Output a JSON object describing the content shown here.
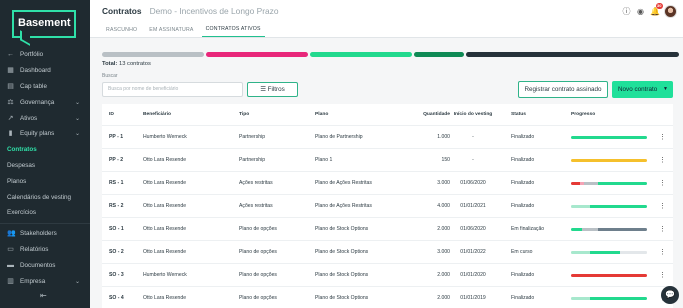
{
  "sidebar": {
    "logo": "Basement",
    "items": [
      {
        "label": "Portfólio",
        "icon": "arrow-left-icon",
        "chevron": false,
        "active": false
      },
      {
        "label": "Dashboard",
        "icon": "grid-icon",
        "chevron": false,
        "active": false
      },
      {
        "label": "Cap table",
        "icon": "table-icon",
        "chevron": false,
        "active": false
      },
      {
        "label": "Governança",
        "icon": "gavel-icon",
        "chevron": true,
        "active": false
      },
      {
        "label": "Ativos",
        "icon": "trend-icon",
        "chevron": true,
        "active": false
      },
      {
        "label": "Equity plans",
        "icon": "bar-chart-icon",
        "chevron": true,
        "active": false
      },
      {
        "label": "Contratos",
        "icon": "",
        "chevron": false,
        "active": true
      },
      {
        "label": "Despesas",
        "icon": "",
        "chevron": false,
        "active": false
      },
      {
        "label": "Planos",
        "icon": "",
        "chevron": false,
        "active": false
      },
      {
        "label": "Calendários de vesting",
        "icon": "",
        "chevron": false,
        "active": false
      },
      {
        "label": "Exercícios",
        "icon": "",
        "chevron": false,
        "active": false
      },
      {
        "label": "Stakeholders",
        "icon": "users-icon",
        "chevron": false,
        "active": false
      },
      {
        "label": "Relatórios",
        "icon": "document-icon",
        "chevron": false,
        "active": false
      },
      {
        "label": "Documentos",
        "icon": "folder-icon",
        "chevron": false,
        "active": false
      },
      {
        "label": "Empresa",
        "icon": "building-icon",
        "chevron": true,
        "active": false
      }
    ],
    "collapse_icon": "collapse-left-icon"
  },
  "header": {
    "title": "Contratos",
    "subtitle": "Demo - Incentivos de Longo Prazo",
    "notification_count": "30"
  },
  "tabs": [
    {
      "label": "RASCUNHO",
      "active": false
    },
    {
      "label": "EM ASSINATURA",
      "active": false
    },
    {
      "label": "CONTRATOS ATIVOS",
      "active": true
    }
  ],
  "status_bars": [
    {
      "color": "#b9c0c5",
      "fraction": 0.179
    },
    {
      "color": "#e8277a",
      "fraction": 0.179
    },
    {
      "color": "#22d98e",
      "fraction": 0.179
    },
    {
      "color": "#0f8a55",
      "fraction": 0.088
    },
    {
      "color": "#26323a",
      "fraction": 0.375
    }
  ],
  "total": {
    "prefix": "Total:",
    "value": "13 contratos"
  },
  "search": {
    "label": "Buscar",
    "placeholder": "Busca por nome de beneficiário"
  },
  "buttons": {
    "filters": "Filtros",
    "register": "Registrar contrato assinado",
    "new_contract": "Novo contrato"
  },
  "table": {
    "headers": {
      "id": "ID",
      "beneficiary": "Beneficiário",
      "type": "Tipo",
      "plan": "Plano",
      "quantity": "Quantidade",
      "vesting_start": "Início do vesting",
      "status": "Status",
      "progress": "Progresso"
    },
    "rows": [
      {
        "id": "PP - 1",
        "beneficiary": "Humberto Werneck",
        "type": "Partnership",
        "plan": "Plano de Partnership",
        "quantity": "1.000",
        "vesting_start": "-",
        "status": "Finalizado",
        "progress": [
          {
            "color": "#22d98e",
            "fraction": 1.0
          }
        ]
      },
      {
        "id": "PP - 2",
        "beneficiary": "Otto Lara Resende",
        "type": "Partnership",
        "plan": "Plano 1",
        "quantity": "150",
        "vesting_start": "-",
        "status": "Finalizado",
        "progress": [
          {
            "color": "#f5c02c",
            "fraction": 1.0
          }
        ]
      },
      {
        "id": "RS - 1",
        "beneficiary": "Otto Lara Resende",
        "type": "Ações restritas",
        "plan": "Plano de Ações Restritas",
        "quantity": "3.000",
        "vesting_start": "01/06/2020",
        "status": "Finalizado",
        "progress": [
          {
            "color": "#e53935",
            "fraction": 0.12
          },
          {
            "color": "#f5a3b5",
            "fraction": 0.05
          },
          {
            "color": "#b9c0c5",
            "fraction": 0.18
          },
          {
            "color": "#22d98e",
            "fraction": 0.65
          }
        ]
      },
      {
        "id": "RS - 2",
        "beneficiary": "Otto Lara Resende",
        "type": "Ações restritas",
        "plan": "Plano de Ações Restritas",
        "quantity": "4.000",
        "vesting_start": "01/01/2021",
        "status": "Finalizado",
        "progress": [
          {
            "color": "#a7e8cd",
            "fraction": 0.25
          },
          {
            "color": "#22d98e",
            "fraction": 0.75
          }
        ]
      },
      {
        "id": "SO - 1",
        "beneficiary": "Otto Lara Resende",
        "type": "Plano de opções",
        "plan": "Plano de Stock Options",
        "quantity": "2.000",
        "vesting_start": "01/06/2020",
        "status": "Em finalização",
        "progress": [
          {
            "color": "#22d98e",
            "fraction": 0.15
          },
          {
            "color": "#b9c0c5",
            "fraction": 0.2
          },
          {
            "color": "#6e7f8c",
            "fraction": 0.65
          }
        ]
      },
      {
        "id": "SO - 2",
        "beneficiary": "Otto Lara Resende",
        "type": "Plano de opções",
        "plan": "Plano de Stock Options",
        "quantity": "3.000",
        "vesting_start": "01/01/2022",
        "status": "Em curso",
        "progress": [
          {
            "color": "#a7e8cd",
            "fraction": 0.25
          },
          {
            "color": "#22d98e",
            "fraction": 0.4
          },
          {
            "color": "#e3e7ea",
            "fraction": 0.35
          }
        ]
      },
      {
        "id": "SO - 3",
        "beneficiary": "Humberto Werneck",
        "type": "Plano de opções",
        "plan": "Plano de Stock Options",
        "quantity": "2.000",
        "vesting_start": "01/01/2020",
        "status": "Finalizado",
        "progress": [
          {
            "color": "#e53935",
            "fraction": 1.0
          }
        ]
      },
      {
        "id": "SO - 4",
        "beneficiary": "Otto Lara Resende",
        "type": "Plano de opções",
        "plan": "Plano de Stock Options",
        "quantity": "2.000",
        "vesting_start": "01/01/2019",
        "status": "Finalizado",
        "progress": [
          {
            "color": "#a7e8cd",
            "fraction": 0.25
          },
          {
            "color": "#22d98e",
            "fraction": 0.75
          }
        ]
      }
    ]
  },
  "chat_icon": "chat-bubble-icon"
}
